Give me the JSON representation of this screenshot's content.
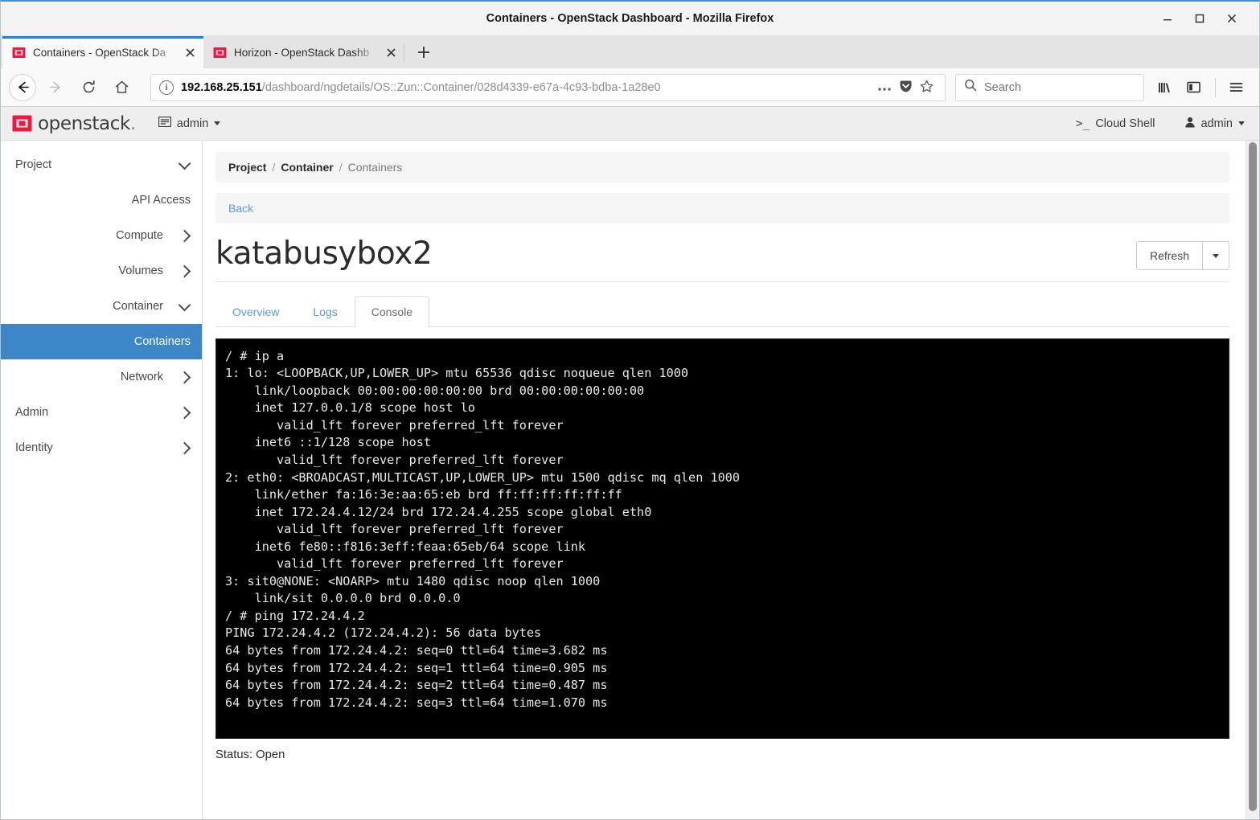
{
  "window": {
    "title": "Containers - OpenStack Dashboard - Mozilla Firefox",
    "minimize_label": "minimize-window",
    "maximize_label": "maximize-window",
    "close_label": "close-window"
  },
  "browser": {
    "tabs": [
      {
        "title": "Containers - OpenStack Da",
        "active": true
      },
      {
        "title": "Horizon - OpenStack Dashb",
        "active": false
      }
    ],
    "new_tab_label": "+",
    "toolbar": {
      "back_label": "Back",
      "forward_label": "Forward",
      "reload_label": "Reload",
      "home_label": "Home",
      "url_host": "192.168.25.151",
      "url_path": "/dashboard/ngdetails/OS::Zun::Container/028d4339-e67a-4c93-bdba-1a28e0",
      "page_actions_label": "...",
      "pocket_label": "Save to Pocket",
      "bookmark_label": "Bookmark this page",
      "search_placeholder": "Search",
      "library_label": "Library",
      "sidebar_label": "Sidebars",
      "menu_label": "Open menu"
    }
  },
  "horizon": {
    "brand": "openstack",
    "brand_dot": ".",
    "project_selector": "admin",
    "cloud_shell": "Cloud Shell",
    "cloud_shell_prefix": ">_",
    "user_menu": "admin",
    "sidebar": {
      "items": [
        {
          "label": "Project",
          "level": 0,
          "chevron": "down",
          "active": false
        },
        {
          "label": "API Access",
          "level": 2,
          "chevron": "none",
          "active": false
        },
        {
          "label": "Compute",
          "level": 1,
          "chevron": "right",
          "active": false
        },
        {
          "label": "Volumes",
          "level": 1,
          "chevron": "right",
          "active": false
        },
        {
          "label": "Container",
          "level": 1,
          "chevron": "down",
          "active": false
        },
        {
          "label": "Containers",
          "level": 2,
          "chevron": "none",
          "active": true
        },
        {
          "label": "Network",
          "level": 1,
          "chevron": "right",
          "active": false
        },
        {
          "label": "Admin",
          "level": 0,
          "chevron": "right",
          "active": false
        },
        {
          "label": "Identity",
          "level": 0,
          "chevron": "right",
          "active": false
        }
      ]
    },
    "breadcrumb": {
      "items": [
        "Project",
        "Container",
        "Containers"
      ],
      "separator": "/"
    },
    "back_link": "Back",
    "page_title": "katabusybox2",
    "refresh_button": "Refresh",
    "tabs": [
      {
        "label": "Overview",
        "selected": false
      },
      {
        "label": "Logs",
        "selected": false
      },
      {
        "label": "Console",
        "selected": true
      }
    ],
    "console_output": "/ # ip a\n1: lo: <LOOPBACK,UP,LOWER_UP> mtu 65536 qdisc noqueue qlen 1000\n    link/loopback 00:00:00:00:00:00 brd 00:00:00:00:00:00\n    inet 127.0.0.1/8 scope host lo\n       valid_lft forever preferred_lft forever\n    inet6 ::1/128 scope host\n       valid_lft forever preferred_lft forever\n2: eth0: <BROADCAST,MULTICAST,UP,LOWER_UP> mtu 1500 qdisc mq qlen 1000\n    link/ether fa:16:3e:aa:65:eb brd ff:ff:ff:ff:ff:ff\n    inet 172.24.4.12/24 brd 172.24.4.255 scope global eth0\n       valid_lft forever preferred_lft forever\n    inet6 fe80::f816:3eff:feaa:65eb/64 scope link\n       valid_lft forever preferred_lft forever\n3: sit0@NONE: <NOARP> mtu 1480 qdisc noop qlen 1000\n    link/sit 0.0.0.0 brd 0.0.0.0\n/ # ping 172.24.4.2\nPING 172.24.4.2 (172.24.4.2): 56 data bytes\n64 bytes from 172.24.4.2: seq=0 ttl=64 time=3.682 ms\n64 bytes from 172.24.4.2: seq=1 ttl=64 time=0.905 ms\n64 bytes from 172.24.4.2: seq=2 ttl=64 time=0.487 ms\n64 bytes from 172.24.4.2: seq=3 ttl=64 time=1.070 ms",
    "status": "Status: Open"
  },
  "colors": {
    "accent_blue": "#3d87c8",
    "link_blue": "#5b9bd5",
    "brand_red": "#ed1944",
    "terminal_bg": "#000000",
    "terminal_fg": "#e8e8e8",
    "firefox_tab_accent": "#0a84ff"
  }
}
